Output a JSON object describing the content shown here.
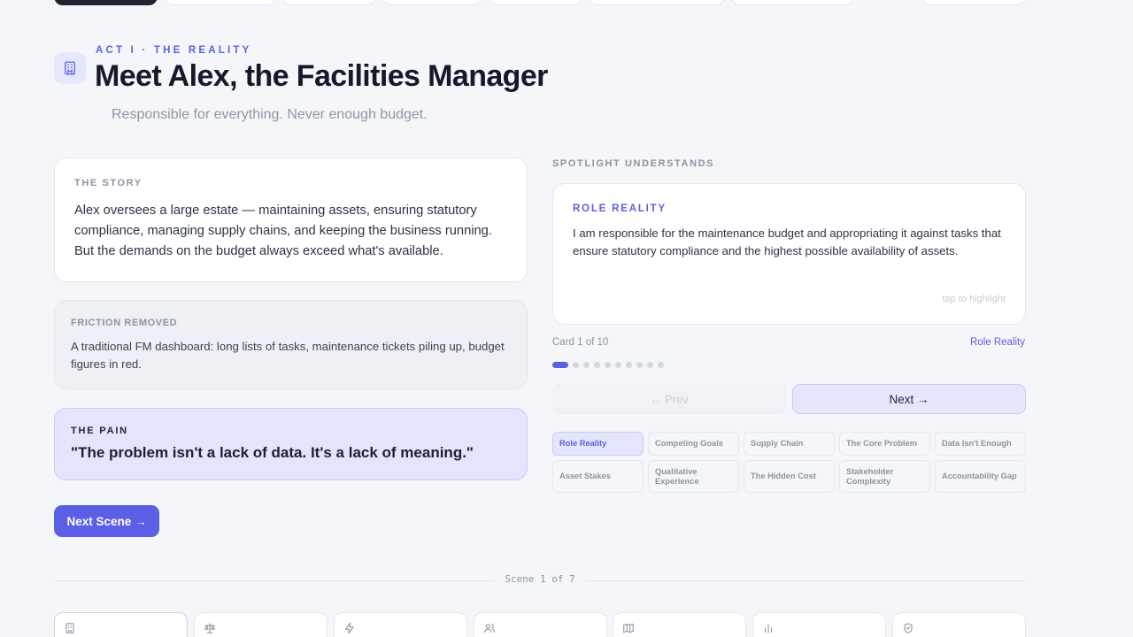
{
  "header": {
    "eyebrow": "ACT I · THE REALITY",
    "title": "Meet Alex, the Facilities Manager",
    "subtitle": "Responsible for everything. Never enough budget.",
    "icon": "building-icon"
  },
  "story": {
    "label": "THE STORY",
    "text": "Alex oversees a large estate — maintaining assets, ensuring statutory compliance, managing supply chains, and keeping the business running. But the demands on the budget always exceed what's available."
  },
  "friction": {
    "label": "FRICTION REMOVED",
    "text": "A traditional FM dashboard: long lists of tasks, maintenance tickets piling up, budget figures in red."
  },
  "pain": {
    "label": "THE PAIN",
    "quote": "\"The problem isn't a lack of data. It's a lack of meaning.\""
  },
  "next_scene_label": "Next Scene →",
  "spotlight": {
    "section_label": "SPOTLIGHT UNDERSTANDS",
    "card_title": "ROLE REALITY",
    "card_text": "I am responsible for the maintenance budget and appropriating it against tasks that ensure statutory compliance and the highest possible availability of assets.",
    "tap_hint": "tap to highlight",
    "card_counter": "Card 1 of 10",
    "card_link": "Role Reality",
    "active_index": 0,
    "total_cards": 10,
    "prev_label": "← Prev",
    "next_label": "Next →",
    "chips": [
      "Role Reality",
      "Competing Goals",
      "Supply Chain",
      "The Core Problem",
      "Data Isn't Enough",
      "Asset Stakes",
      "Qualitative Experience",
      "The Hidden Cost",
      "Stakeholder Complexity",
      "Accountability Gap"
    ]
  },
  "scene_indicator": "Scene 1 of 7",
  "bottom_nav": {
    "icons": [
      "building-icon",
      "scale-icon",
      "lightning-icon",
      "people-icon",
      "map-icon",
      "bar-chart-icon",
      "shield-check-icon"
    ],
    "active_index": 0
  },
  "colors": {
    "accent": "#5b5fe6",
    "background": "#f5f6f9",
    "pain_bg": "#e2e5fb"
  }
}
